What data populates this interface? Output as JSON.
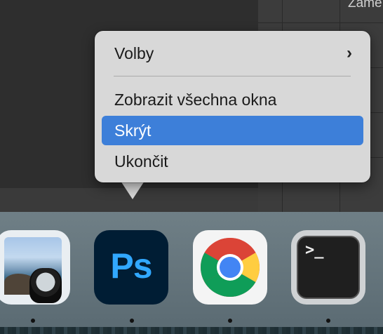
{
  "background_window": {
    "partial_text": "Zame"
  },
  "context_menu": {
    "items": [
      {
        "label": "Volby",
        "has_submenu": true,
        "submenu_glyph": "›"
      },
      {
        "label": "Zobrazit všechna okna"
      },
      {
        "label": "Skrýt",
        "selected": true
      },
      {
        "label": "Ukončit"
      }
    ],
    "highlight_color": "#3d7fd9"
  },
  "dock": {
    "apps": [
      {
        "name": "Preview",
        "icon": "preview-icon",
        "running": true
      },
      {
        "name": "Photoshop",
        "icon": "photoshop-icon",
        "icon_text": "Ps",
        "running": true
      },
      {
        "name": "Google Chrome",
        "icon": "chrome-icon",
        "running": true
      },
      {
        "name": "Terminal",
        "icon": "terminal-icon",
        "icon_text": ">_",
        "running": true
      }
    ]
  }
}
